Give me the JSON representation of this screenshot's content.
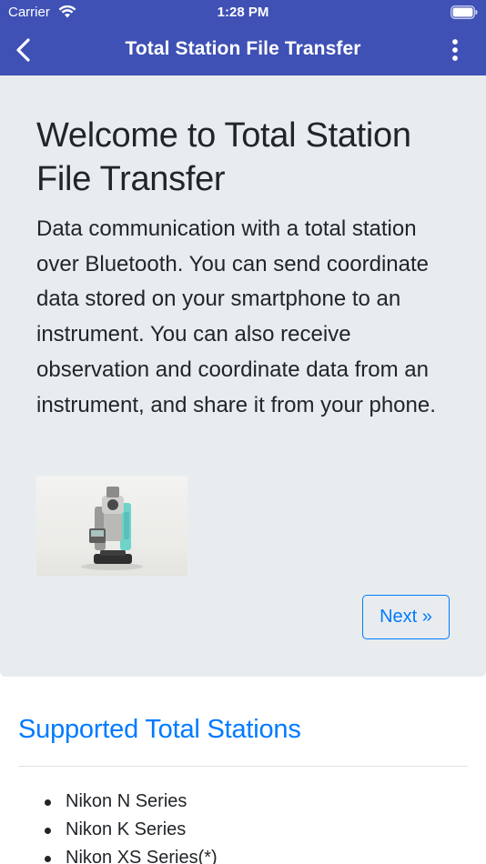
{
  "status_bar": {
    "carrier": "Carrier",
    "time": "1:28 PM"
  },
  "nav": {
    "title": "Total Station File Transfer",
    "back_icon": "chevron-left-icon",
    "menu_icon": "more-vertical-icon"
  },
  "hero": {
    "heading": "Welcome to Total Station File Transfer",
    "description": "Data communication with a total station over Bluetooth. You can send coordinate data stored on your smartphone to an instrument. You can also receive observation and coordinate data from an instrument, and share it from your phone.",
    "next_label": "Next »"
  },
  "supported": {
    "title": "Supported Total Stations",
    "items": [
      "Nikon N Series",
      "Nikon K Series",
      "Nikon XS Series(*)"
    ]
  },
  "colors": {
    "nav_bg": "#3f51b5",
    "hero_bg": "#e9ecef",
    "accent": "#007bff"
  }
}
